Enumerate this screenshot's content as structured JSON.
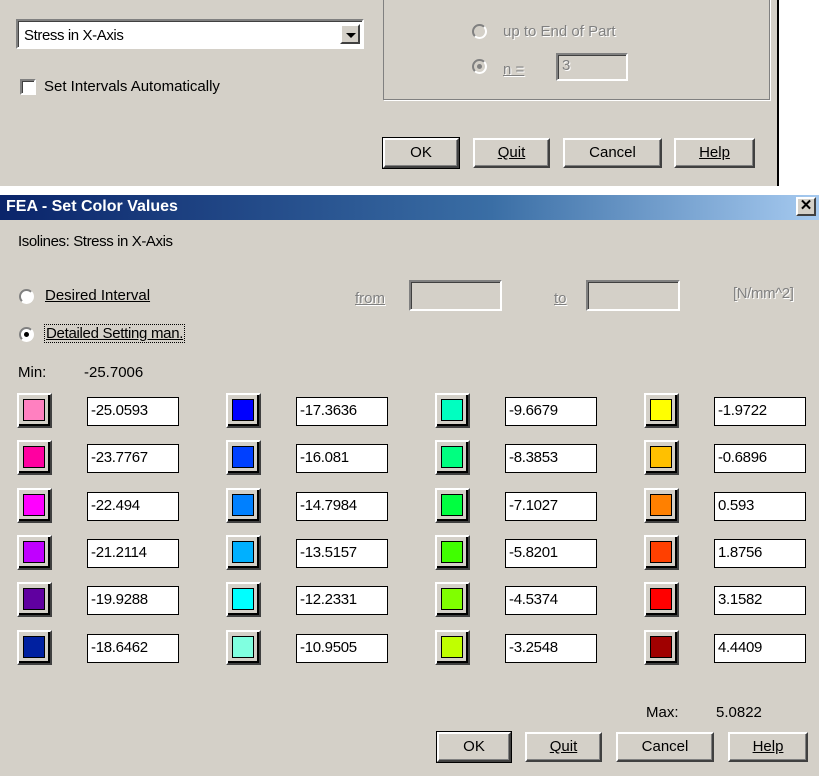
{
  "background_dialog": {
    "combo_value": "Stress in X-Axis",
    "set_intervals_label": "Set Intervals Automatically",
    "radio_end_label": "up to End of Part",
    "radio_n_label": "n =",
    "n_value": "3",
    "ok_label": "OK",
    "quit_label": "Quit",
    "cancel_label": "Cancel",
    "help_label": "Help"
  },
  "dialog": {
    "title": "FEA - Set Color Values",
    "close_glyph": "✕",
    "isolines_label": "Isolines:  Stress in X-Axis",
    "desired_interval_label": "Desired Interval",
    "from_label": "from",
    "to_label": "to",
    "unit_label": "[N/mm^2]",
    "detailed_setting_label": "Detailed Setting man.",
    "min_label": "Min:",
    "min_value": "-25.7006",
    "max_label": "Max:",
    "max_value": "5.0822",
    "ok_label": "OK",
    "quit_label": "Quit",
    "cancel_label": "Cancel",
    "help_label": "Help"
  },
  "color_columns": [
    [
      {
        "color": "#ff80c0",
        "value": "-25.0593"
      },
      {
        "color": "#ff00a0",
        "value": "-23.7767"
      },
      {
        "color": "#ff00ff",
        "value": "-22.494"
      },
      {
        "color": "#c000ff",
        "value": "-21.2114"
      },
      {
        "color": "#6000a0",
        "value": "-19.9288"
      },
      {
        "color": "#0020a0",
        "value": "-18.6462"
      }
    ],
    [
      {
        "color": "#0000ff",
        "value": "-17.3636"
      },
      {
        "color": "#0040ff",
        "value": "-16.081"
      },
      {
        "color": "#0080ff",
        "value": "-14.7984"
      },
      {
        "color": "#00b0ff",
        "value": "-13.5157"
      },
      {
        "color": "#00ffff",
        "value": "-12.2331"
      },
      {
        "color": "#80ffe0",
        "value": "-10.9505"
      }
    ],
    [
      {
        "color": "#00ffc0",
        "value": "-9.6679"
      },
      {
        "color": "#00ff80",
        "value": "-8.3853"
      },
      {
        "color": "#00ff40",
        "value": "-7.1027"
      },
      {
        "color": "#40ff00",
        "value": "-5.8201"
      },
      {
        "color": "#80ff00",
        "value": "-4.5374"
      },
      {
        "color": "#c0ff00",
        "value": "-3.2548"
      }
    ],
    [
      {
        "color": "#ffff00",
        "value": "-1.9722"
      },
      {
        "color": "#ffc000",
        "value": "-0.6896"
      },
      {
        "color": "#ff8000",
        "value": "0.593"
      },
      {
        "color": "#ff4000",
        "value": "1.8756"
      },
      {
        "color": "#ff0000",
        "value": "3.1582"
      },
      {
        "color": "#a00000",
        "value": "4.4409"
      }
    ]
  ]
}
